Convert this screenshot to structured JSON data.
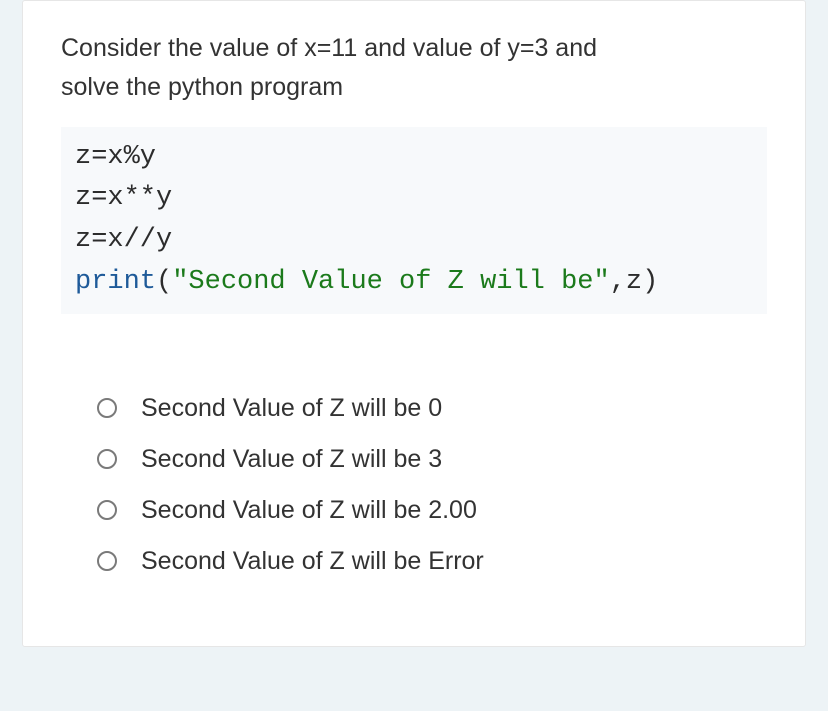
{
  "question": {
    "prompt_line1": "Consider the value of x=11 and value of y=3 and",
    "prompt_line2": "solve the python program"
  },
  "code": {
    "line1": "z=x%y",
    "line2": "z=x**y",
    "line3": "z=x//y",
    "line4_func": "print",
    "line4_paren_open": "(",
    "line4_string": "\"Second Value of Z will be\"",
    "line4_rest": ",z)"
  },
  "options": [
    {
      "label": "Second Value of Z will be 0"
    },
    {
      "label": "Second Value of Z will be 3"
    },
    {
      "label": "Second Value of Z will be 2.00"
    },
    {
      "label": "Second Value of Z will be Error"
    }
  ]
}
